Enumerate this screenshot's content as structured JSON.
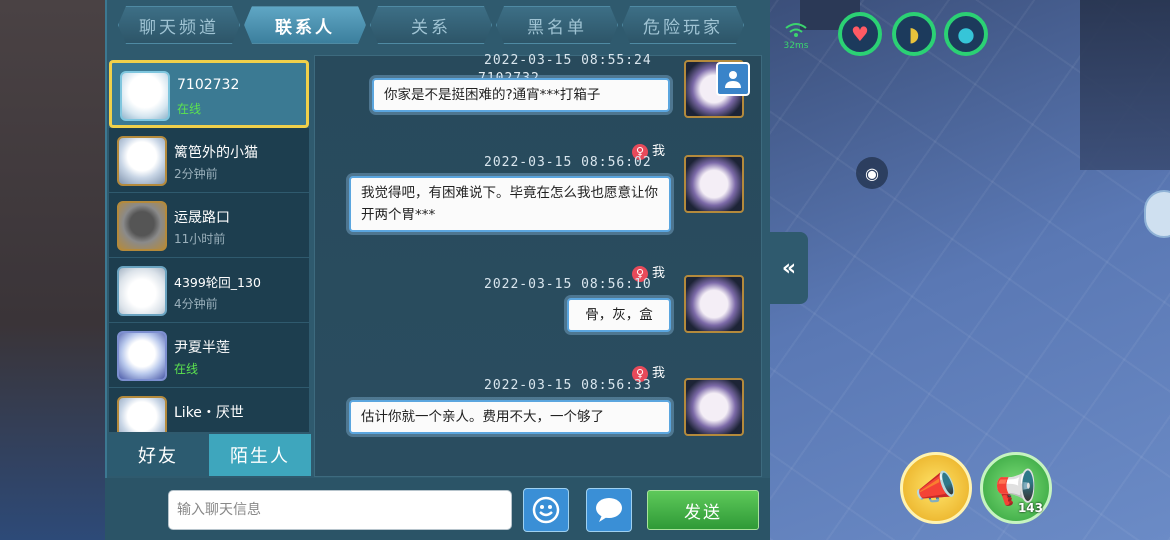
{
  "tabs": [
    "聊天频道",
    "联系人",
    "关系",
    "黑名单",
    "危险玩家"
  ],
  "active_tab": 1,
  "contacts": [
    {
      "name": "7102732",
      "status": "在线",
      "online": true
    },
    {
      "name": "篱笆外的小猫",
      "status": "2分钟前",
      "online": false
    },
    {
      "name": "运晟路口",
      "status": "11小时前",
      "online": false
    },
    {
      "name": "4399轮回_130",
      "status": "4分钟前",
      "online": false
    },
    {
      "name": "尹夏半莲",
      "status": "在线",
      "online": true
    },
    {
      "name": "Like・厌世",
      "status": "",
      "online": false
    }
  ],
  "friend_tabs": {
    "friends": "好友",
    "strangers": "陌生人"
  },
  "messages": [
    {
      "timestamp": "2022-03-15  08:55:24",
      "sender": "7102732",
      "text": "你家是不是挺困难的?通宵***打箱子",
      "mine": false
    },
    {
      "timestamp": "2022-03-15  08:56:02",
      "sender": "我",
      "text": "我觉得吧，有困难说下。毕竟在怎么我也愿意让你开两个胃***",
      "mine": true
    },
    {
      "timestamp": "2022-03-15  08:56:10",
      "sender": "我",
      "text": "骨，灰，盒",
      "mine": true
    },
    {
      "timestamp": "2022-03-15  08:56:33",
      "sender": "我",
      "text": "估计你就一个亲人。费用不大，一个够了",
      "mine": true
    }
  ],
  "input": {
    "placeholder": "输入聊天信息"
  },
  "send_label": "发送",
  "ping": "32ms",
  "horn_count": "143",
  "colors": {
    "online": "#5ce34f",
    "send": "#2f9a37",
    "selected_border": "#f0d04a"
  }
}
